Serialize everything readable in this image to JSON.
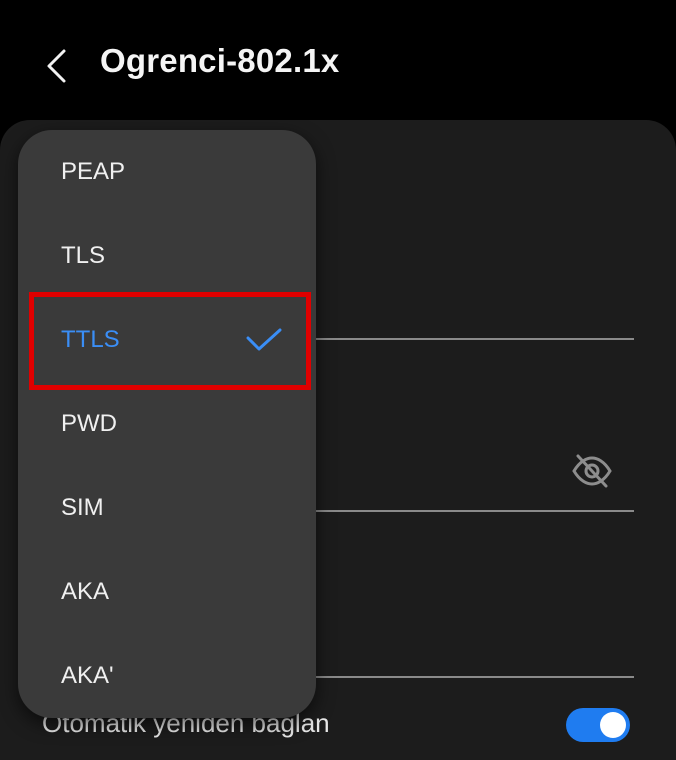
{
  "header": {
    "title": "Ogrenci-802.1x",
    "back_icon": "chevron-left-icon"
  },
  "eap_menu": {
    "items": [
      {
        "label": "PEAP",
        "selected": false
      },
      {
        "label": "TLS",
        "selected": false
      },
      {
        "label": "TTLS",
        "selected": true
      },
      {
        "label": "PWD",
        "selected": false
      },
      {
        "label": "SIM",
        "selected": false
      },
      {
        "label": "AKA",
        "selected": false
      },
      {
        "label": "AKA'",
        "selected": false
      }
    ],
    "check_icon": "checkmark-icon"
  },
  "settings": {
    "password_visibility_icon": "eye-off-icon",
    "auto_reconnect_label": "Otomatik yeniden bağlan",
    "auto_reconnect_enabled": true
  },
  "colors": {
    "background": "#000000",
    "card": "#1c1c1c",
    "menu": "#3a3a3a",
    "accent": "#3a8ef6",
    "toggle_on": "#1f7cf0",
    "highlight": "#e00000"
  }
}
